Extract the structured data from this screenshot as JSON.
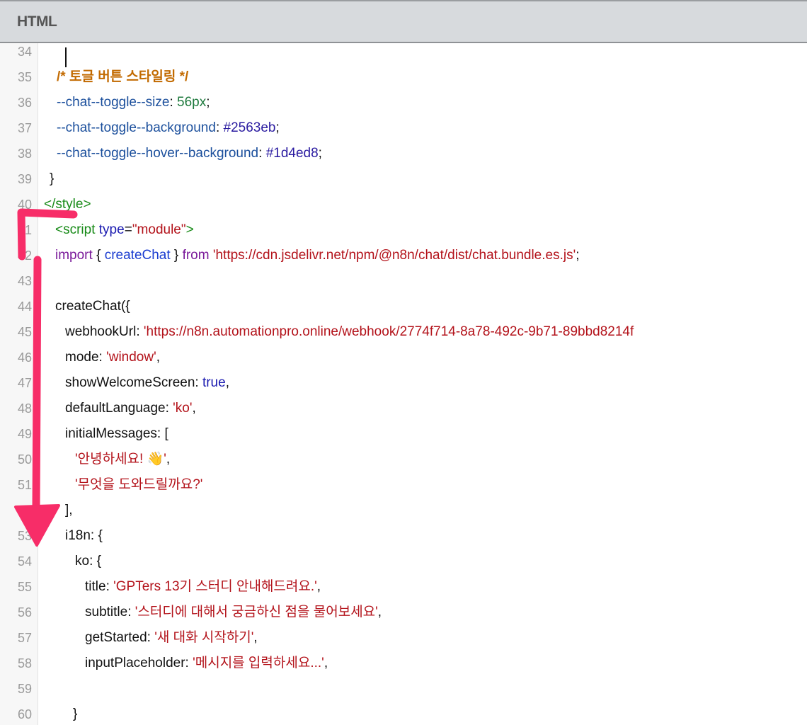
{
  "header": {
    "title": "HTML"
  },
  "accent_color": "#f72d68",
  "lines": [
    {
      "n": "34",
      "tokens": []
    },
    {
      "n": "35",
      "tokens": [
        {
          "k": "comment",
          "t": "/* 토글 버튼 스타일링 */"
        }
      ]
    },
    {
      "n": "36",
      "tokens": [
        {
          "k": "prop",
          "t": "--chat--toggle--size"
        },
        {
          "k": "plain",
          "t": ": "
        },
        {
          "k": "num",
          "t": "56px"
        },
        {
          "k": "plain",
          "t": ";"
        }
      ]
    },
    {
      "n": "37",
      "tokens": [
        {
          "k": "prop",
          "t": "--chat--toggle--background"
        },
        {
          "k": "plain",
          "t": ": "
        },
        {
          "k": "hex",
          "t": "#2563eb"
        },
        {
          "k": "plain",
          "t": ";"
        }
      ]
    },
    {
      "n": "38",
      "tokens": [
        {
          "k": "prop",
          "t": "--chat--toggle--hover--background"
        },
        {
          "k": "plain",
          "t": ": "
        },
        {
          "k": "hex",
          "t": "#1d4ed8"
        },
        {
          "k": "plain",
          "t": ";"
        }
      ]
    },
    {
      "n": "39",
      "tokens": [
        {
          "k": "plain",
          "t": "}"
        }
      ]
    },
    {
      "n": "40",
      "tokens": [
        {
          "k": "tag",
          "t": "</style>"
        }
      ]
    },
    {
      "n": "41",
      "tokens": [
        {
          "k": "tag",
          "t": "<script "
        },
        {
          "k": "attr",
          "t": "type"
        },
        {
          "k": "plain",
          "t": "="
        },
        {
          "k": "str",
          "t": "\"module\""
        },
        {
          "k": "tag",
          "t": ">"
        }
      ]
    },
    {
      "n": "42",
      "tokens": [
        {
          "k": "kw",
          "t": "import"
        },
        {
          "k": "plain",
          "t": " { "
        },
        {
          "k": "fn",
          "t": "createChat"
        },
        {
          "k": "plain",
          "t": " } "
        },
        {
          "k": "kw",
          "t": "from"
        },
        {
          "k": "plain",
          "t": " "
        },
        {
          "k": "str",
          "t": "'https://cdn.jsdelivr.net/npm/@n8n/chat/dist/chat.bundle.es.js'"
        },
        {
          "k": "plain",
          "t": ";"
        }
      ]
    },
    {
      "n": "43",
      "tokens": []
    },
    {
      "n": "44",
      "tokens": [
        {
          "k": "plain",
          "t": "createChat({"
        }
      ]
    },
    {
      "n": "45",
      "tokens": [
        {
          "k": "plain",
          "t": "webhookUrl: "
        },
        {
          "k": "str",
          "t": "'https://n8n.automationpro.online/webhook/2774f714-8a78-492c-9b71-89bbd8214f"
        }
      ]
    },
    {
      "n": "46",
      "tokens": [
        {
          "k": "plain",
          "t": "mode: "
        },
        {
          "k": "str",
          "t": "'window'"
        },
        {
          "k": "plain",
          "t": ","
        }
      ]
    },
    {
      "n": "47",
      "tokens": [
        {
          "k": "plain",
          "t": "showWelcomeScreen: "
        },
        {
          "k": "bool",
          "t": "true"
        },
        {
          "k": "plain",
          "t": ","
        }
      ]
    },
    {
      "n": "48",
      "tokens": [
        {
          "k": "plain",
          "t": "defaultLanguage: "
        },
        {
          "k": "str",
          "t": "'ko'"
        },
        {
          "k": "plain",
          "t": ","
        }
      ]
    },
    {
      "n": "49",
      "tokens": [
        {
          "k": "plain",
          "t": "initialMessages: ["
        }
      ]
    },
    {
      "n": "50",
      "tokens": [
        {
          "k": "str",
          "t": "'안녕하세요! 👋'"
        },
        {
          "k": "plain",
          "t": ","
        }
      ]
    },
    {
      "n": "51",
      "tokens": [
        {
          "k": "str",
          "t": "'무엇을 도와드릴까요?'"
        }
      ]
    },
    {
      "n": "52",
      "tokens": [
        {
          "k": "plain",
          "t": "],"
        }
      ]
    },
    {
      "n": "53",
      "tokens": [
        {
          "k": "plain",
          "t": "i18n: {"
        }
      ]
    },
    {
      "n": "54",
      "tokens": [
        {
          "k": "plain",
          "t": "ko: {"
        }
      ]
    },
    {
      "n": "55",
      "tokens": [
        {
          "k": "plain",
          "t": "title: "
        },
        {
          "k": "str",
          "t": "'GPTers 13기 스터디 안내해드려요.'"
        },
        {
          "k": "plain",
          "t": ","
        }
      ]
    },
    {
      "n": "56",
      "tokens": [
        {
          "k": "plain",
          "t": "subtitle: "
        },
        {
          "k": "str",
          "t": "'스터디에 대해서 궁금하신 점을 물어보세요'"
        },
        {
          "k": "plain",
          "t": ","
        }
      ]
    },
    {
      "n": "57",
      "tokens": [
        {
          "k": "plain",
          "t": "getStarted: "
        },
        {
          "k": "str",
          "t": "'새 대화 시작하기'"
        },
        {
          "k": "plain",
          "t": ","
        }
      ]
    },
    {
      "n": "58",
      "tokens": [
        {
          "k": "plain",
          "t": "inputPlaceholder: "
        },
        {
          "k": "str",
          "t": "'메시지를 입력하세요...'"
        },
        {
          "k": "plain",
          "t": ","
        }
      ]
    },
    {
      "n": "59",
      "tokens": []
    },
    {
      "n": "60",
      "tokens": [
        {
          "k": "plain",
          "t": "}"
        }
      ]
    }
  ]
}
